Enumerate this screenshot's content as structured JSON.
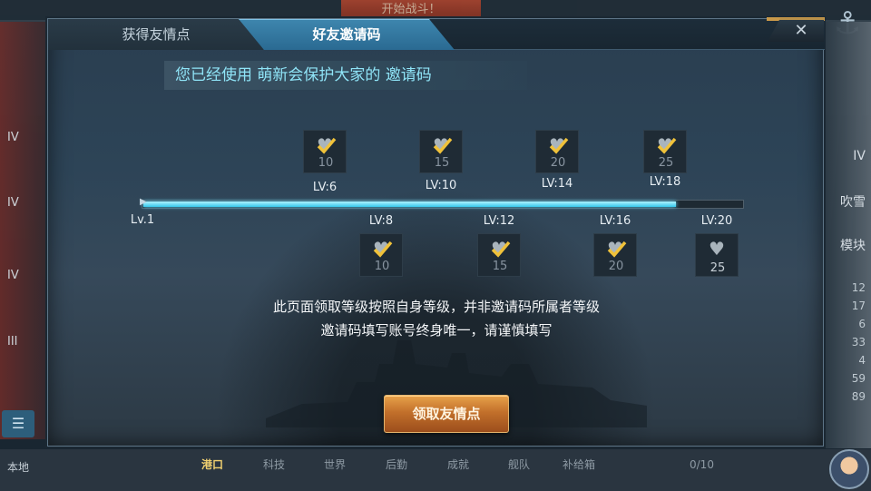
{
  "background": {
    "start_button": "开始战斗！",
    "left_levels": [
      "IV",
      "IV",
      "IV",
      "III"
    ],
    "right_numbers": [
      "12",
      "17",
      "6",
      "33",
      "4",
      "59",
      "89"
    ],
    "right_labels": [
      "IV",
      "吹雪",
      "模块"
    ],
    "bottom_tabs": [
      "港口",
      "科技",
      "世界",
      "后勤",
      "成就",
      "舰队",
      "补给箱"
    ],
    "local_label": "本地",
    "capacity": "0/10",
    "list_icon": "list-icon",
    "anchor_icon": "anchor-icon"
  },
  "modal": {
    "tabs": [
      {
        "label": "获得友情点",
        "active": false
      },
      {
        "label": "好友邀请码",
        "active": true
      }
    ],
    "close_label": "✕",
    "banner": {
      "prefix": "您已经使用",
      "inviter": "萌新会保护大家的",
      "suffix": "邀请码"
    },
    "progress": {
      "start_label": "Lv.1",
      "current_fraction": 0.89,
      "top_levels": [
        "LV:6",
        "LV:10",
        "LV:14",
        "LV:18"
      ],
      "bottom_levels": [
        "LV:8",
        "LV:12",
        "LV:16",
        "LV:20"
      ]
    },
    "rewards_top": [
      {
        "amount": "10",
        "claimed": true
      },
      {
        "amount": "15",
        "claimed": true
      },
      {
        "amount": "20",
        "claimed": true
      },
      {
        "amount": "25",
        "claimed": true
      }
    ],
    "rewards_bottom": [
      {
        "amount": "10",
        "claimed": true
      },
      {
        "amount": "15",
        "claimed": true
      },
      {
        "amount": "20",
        "claimed": true
      },
      {
        "amount": "25",
        "claimed": false
      }
    ],
    "notice_line1": "此页面领取等级按照自身等级，并非邀请码所属者等级",
    "notice_line2": "邀请码填写账号终身唯一，请谨慎填写",
    "claim_button": "领取友情点",
    "icons": {
      "reward": "heart-icon",
      "claimed": "checkmark-icon"
    },
    "colors": {
      "accent": "#36c8ec",
      "claimed_check": "#f0c23a",
      "button": "#c2702b"
    }
  }
}
